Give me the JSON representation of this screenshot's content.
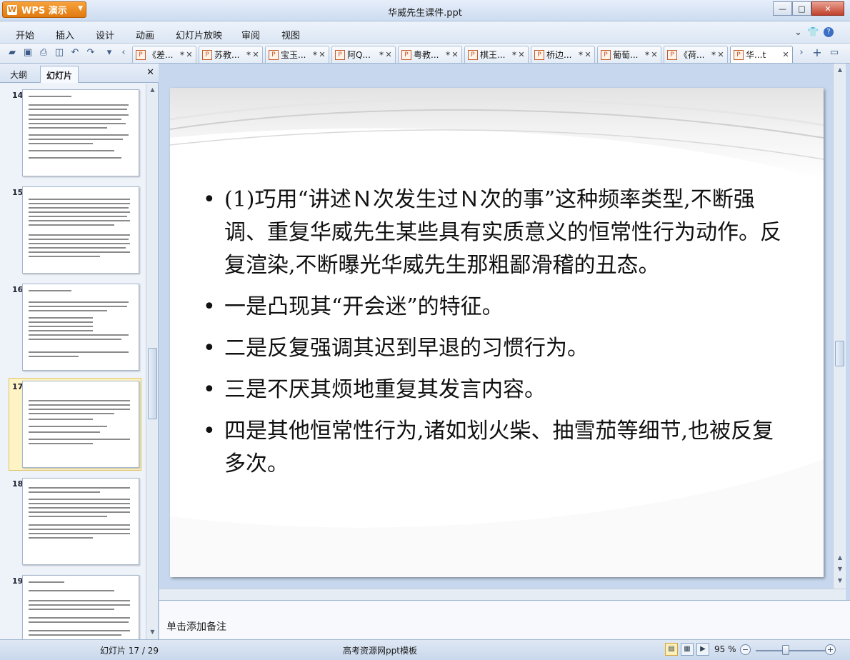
{
  "app": {
    "name": "WPS 演示",
    "logo_glyph": "W"
  },
  "window": {
    "title": "华威先生课件.ppt",
    "minimize": "—",
    "maximize": "□",
    "close": "✕"
  },
  "menu": {
    "items": [
      "开始",
      "插入",
      "设计",
      "动画",
      "幻灯片放映",
      "审阅",
      "视图"
    ],
    "right": {
      "collapse": "⌄",
      "skin": "👕",
      "help": "?"
    }
  },
  "doc_tabs": [
    {
      "label": "《差...",
      "modified": "*"
    },
    {
      "label": "苏教...",
      "modified": "*"
    },
    {
      "label": "宝玉...",
      "modified": "*"
    },
    {
      "label": "阿Q...",
      "modified": "*"
    },
    {
      "label": "粤教...",
      "modified": "*"
    },
    {
      "label": "棋王...",
      "modified": "*"
    },
    {
      "label": "桥边...",
      "modified": "*"
    },
    {
      "label": "葡萄...",
      "modified": "*"
    },
    {
      "label": "《荷...",
      "modified": "*"
    },
    {
      "label": "华...t",
      "modified": "",
      "active": true
    }
  ],
  "panel": {
    "tabs": [
      "大纲",
      "幻灯片"
    ],
    "active_tab": "幻灯片",
    "close": "✕",
    "thumbnails": [
      {
        "number": "14"
      },
      {
        "number": "15"
      },
      {
        "number": "16"
      },
      {
        "number": "17",
        "selected": true
      },
      {
        "number": "18"
      },
      {
        "number": "19"
      }
    ]
  },
  "slide": {
    "bullets": [
      "(1)巧用“讲述Ｎ次发生过Ｎ次的事”这种频率类型,不断强调、重复华威先生某些具有实质意义的恒常性行为动作。反复渲染,不断曝光华威先生那粗鄙滑稽的丑态。",
      "一是凸现其“开会迷”的特征。",
      "二是反复强调其迟到早退的习惯行为。",
      "三是不厌其烦地重复其发言内容。",
      "四是其他恒常性行为,诸如划火柴、抽雪茄等细节,也被反复多次。"
    ]
  },
  "notes": {
    "placeholder": "单击添加备注"
  },
  "status": {
    "slide_indicator": "幻灯片 17 / 29",
    "template": "高考资源网ppt模板",
    "zoom": "95 %",
    "zoom_minus": "−",
    "zoom_plus": "+"
  },
  "colors": {
    "app_orange": "#e07a10",
    "chrome_blue": "#c9d9ee",
    "selected_thumb": "#fdf3c4"
  }
}
